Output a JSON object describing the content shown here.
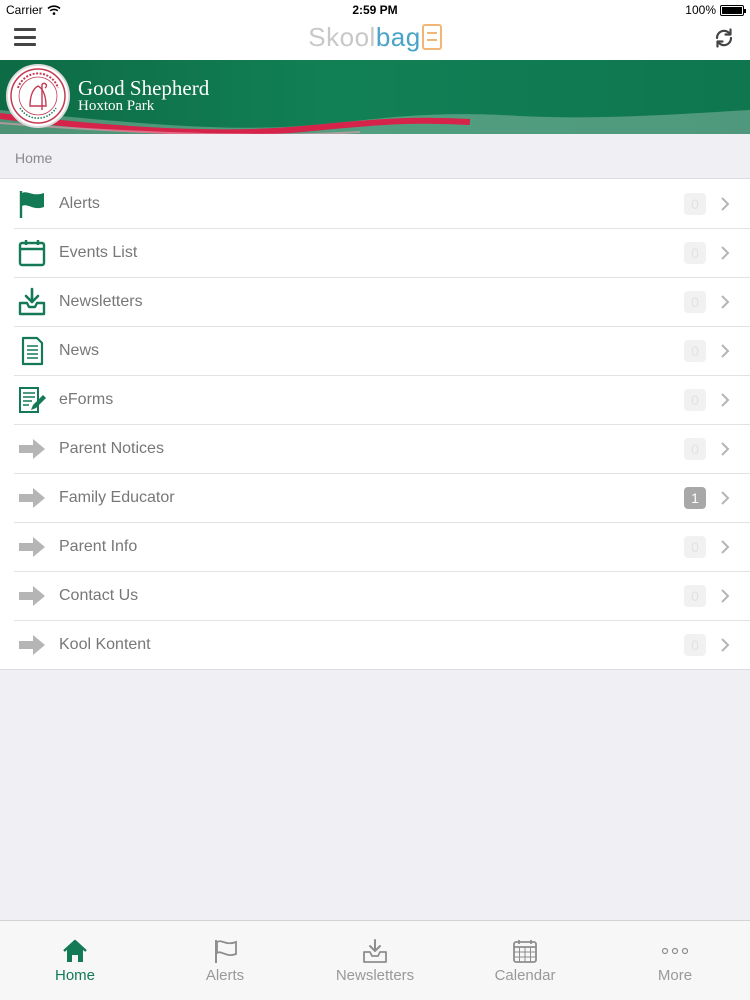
{
  "status_bar": {
    "carrier": "Carrier",
    "time": "2:59 PM",
    "battery": "100%"
  },
  "nav": {
    "brand_part1": "Skool",
    "brand_part2": "bag",
    "menu_icon": "hamburger-icon",
    "refresh_icon": "refresh-icon"
  },
  "banner": {
    "school_name": "Good Shepherd",
    "school_subtitle": "Hoxton Park"
  },
  "breadcrumb": "Home",
  "menu_items": [
    {
      "label": "Alerts",
      "icon": "flag-icon",
      "badge": "0"
    },
    {
      "label": "Events List",
      "icon": "calendar-icon",
      "badge": "0"
    },
    {
      "label": "Newsletters",
      "icon": "inbox-download-icon",
      "badge": "0"
    },
    {
      "label": "News",
      "icon": "document-icon",
      "badge": "0"
    },
    {
      "label": "eForms",
      "icon": "form-edit-icon",
      "badge": "0"
    },
    {
      "label": "Parent Notices",
      "icon": "arrow-right-icon",
      "badge": "0"
    },
    {
      "label": "Family Educator",
      "icon": "arrow-right-icon",
      "badge": "1"
    },
    {
      "label": "Parent Info",
      "icon": "arrow-right-icon",
      "badge": "0"
    },
    {
      "label": "Contact Us",
      "icon": "arrow-right-icon",
      "badge": "0"
    },
    {
      "label": "Kool Kontent",
      "icon": "arrow-right-icon",
      "badge": "0"
    }
  ],
  "tabs": [
    {
      "label": "Home",
      "icon": "home-icon",
      "active": true
    },
    {
      "label": "Alerts",
      "icon": "flag-icon",
      "active": false
    },
    {
      "label": "Newsletters",
      "icon": "inbox-download-icon",
      "active": false
    },
    {
      "label": "Calendar",
      "icon": "calendar-grid-icon",
      "active": false
    },
    {
      "label": "More",
      "icon": "more-dots-icon",
      "active": false
    }
  ],
  "colors": {
    "brand_green": "#137a55",
    "banner_red": "#d5234a",
    "skool_grey": "#c8c8c8",
    "bag_blue": "#4aa4c8",
    "icon_grey": "#b5b5b5"
  }
}
